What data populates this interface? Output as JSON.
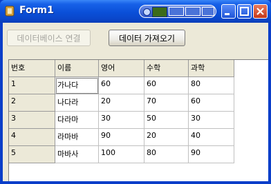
{
  "window": {
    "title": "Form1"
  },
  "buttons": {
    "connect_label": "데이터베이스 연결",
    "fetch_label": "데이터 가져오기"
  },
  "grid": {
    "columns": [
      "번호",
      "이름",
      "영어",
      "수학",
      "과학"
    ],
    "rows": [
      [
        "1",
        "가나다",
        "60",
        "60",
        "80"
      ],
      [
        "2",
        "나다라",
        "20",
        "70",
        "60"
      ],
      [
        "3",
        "다라마",
        "30",
        "50",
        "30"
      ],
      [
        "4",
        "라마바",
        "90",
        "20",
        "40"
      ],
      [
        "5",
        "마바사",
        "100",
        "80",
        "90"
      ]
    ]
  },
  "colors": {
    "titlebar": "#0a4fd8",
    "client": "#ece9d8"
  }
}
